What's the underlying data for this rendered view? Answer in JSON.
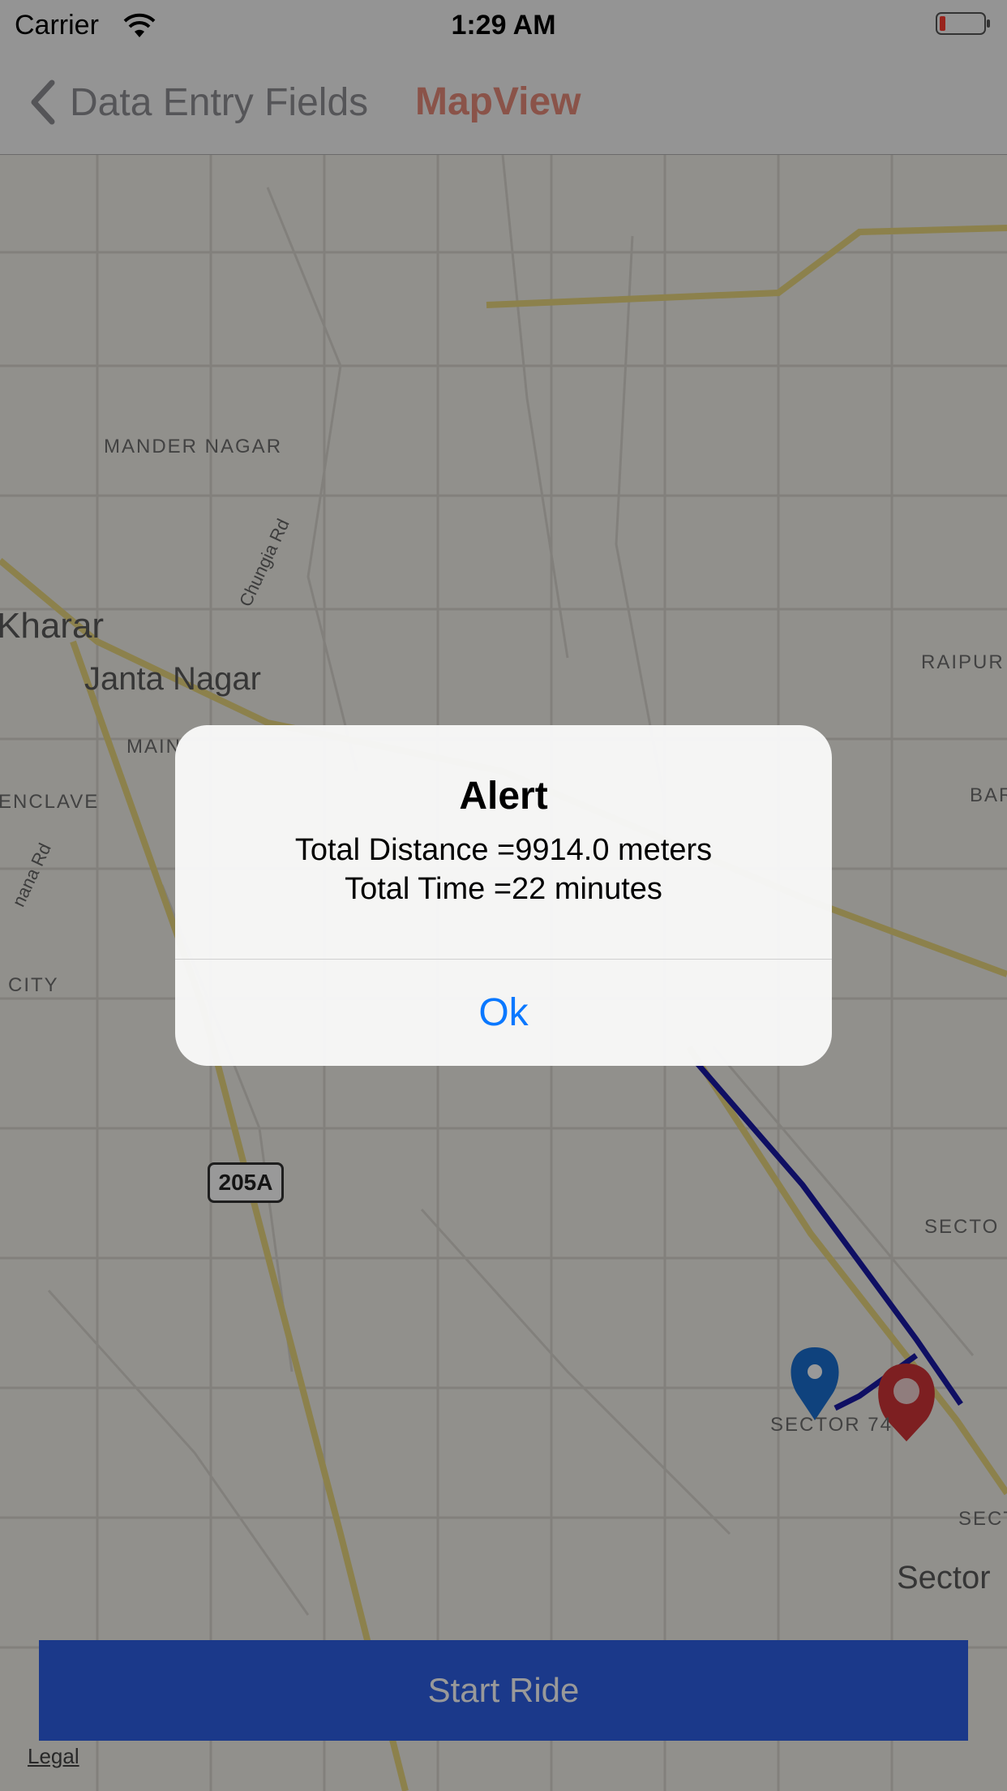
{
  "status_bar": {
    "carrier": "Carrier",
    "time": "1:29 AM"
  },
  "nav": {
    "back_label": "Data Entry Fields",
    "title": "MapView"
  },
  "map": {
    "labels": {
      "mander_nagar": "MANDER NAGAR",
      "chungia_rd": "Chungia Rd",
      "kharar": "Kharar",
      "janta_nagar": "Janta Nagar",
      "main": "MAIN",
      "enclave": "ENCLAVE",
      "ana_rd": "nana Rd",
      "city": "CITY",
      "raipur": "RAIPUR",
      "bar": "BAR",
      "sector_right": "SECTO",
      "sector74": "SECTOR 74",
      "sec": "SECT",
      "sector_big": "Sector"
    },
    "highway_shield": "205A",
    "route_color": "#1a1aa6",
    "start_pin_color": "#1a6fd1",
    "end_pin_color": "#d13438"
  },
  "start_button": "Start Ride",
  "legal": "Legal",
  "alert": {
    "title": "Alert",
    "line1": "Total Distance =9914.0 meters",
    "line2": "Total Time =22 minutes",
    "ok": "Ok"
  }
}
